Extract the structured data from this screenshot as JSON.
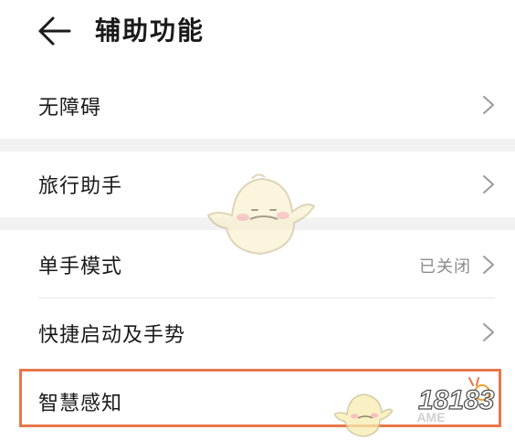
{
  "header": {
    "title": "辅助功能",
    "back_icon": "arrow-left-icon"
  },
  "settings": {
    "items": [
      {
        "label": "无障碍",
        "value": "",
        "icon": "chevron-right-icon"
      },
      {
        "label": "旅行助手",
        "value": "",
        "icon": "chevron-right-icon"
      },
      {
        "label": "单手模式",
        "value": "已关闭",
        "icon": "chevron-right-icon"
      },
      {
        "label": "快捷启动及手势",
        "value": "",
        "icon": "chevron-right-icon"
      },
      {
        "label": "智慧感知",
        "value": "",
        "icon": "chevron-right-icon"
      }
    ]
  },
  "watermark": {
    "logo_text": "18183",
    "logo_subtext": "3DMGAME"
  },
  "colors": {
    "highlight": "#e8774a",
    "group_gap": "#f2f2f2",
    "secondary_text": "#8c8c8c"
  }
}
